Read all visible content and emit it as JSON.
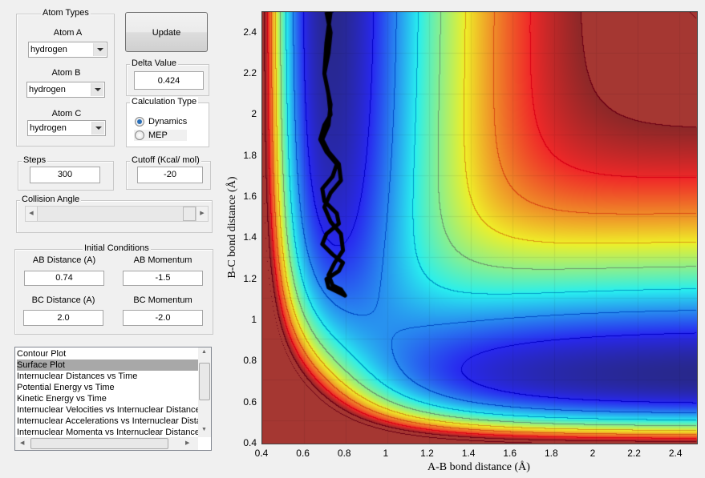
{
  "atom_types": {
    "title": "Atom Types",
    "atom_a_label": "Atom A",
    "atom_a": "hydrogen",
    "atom_b_label": "Atom B",
    "atom_b": "hydrogen",
    "atom_c_label": "Atom C",
    "atom_c": "hydrogen"
  },
  "update_label": "Update",
  "delta": {
    "title": "Delta Value",
    "value": "0.424"
  },
  "calc_type": {
    "title": "Calculation Type",
    "options": [
      "Dynamics",
      "MEP"
    ],
    "selected": "Dynamics"
  },
  "steps": {
    "title": "Steps",
    "value": "300"
  },
  "cutoff": {
    "title": "Cutoff (Kcal/ mol)",
    "value": "-20"
  },
  "collision_angle": {
    "title": "Collision Angle"
  },
  "initial": {
    "title": "Initial Conditions",
    "ab_dist_label": "AB Distance (A)",
    "ab_dist": "0.74",
    "ab_mom_label": "AB Momentum",
    "ab_mom": "-1.5",
    "bc_dist_label": "BC Distance (A)",
    "bc_dist": "2.0",
    "bc_mom_label": "BC Momentum",
    "bc_mom": "-2.0"
  },
  "plot_list": {
    "items": [
      "Contour Plot",
      "Surface Plot",
      "Internuclear Distances vs Time",
      "Potential Energy vs Time",
      "Kinetic Energy vs Time",
      "Internuclear Velocities vs Internuclear Distance",
      "Internuclear Accelerations vs Internuclear Distance",
      "Internuclear Momenta vs Internuclear Distance"
    ],
    "selected": "Surface Plot"
  },
  "chart_data": {
    "type": "contour",
    "xlabel": "A-B bond distance (Å)",
    "ylabel": "B-C bond distance (Å)",
    "xlim": [
      0.4,
      2.5
    ],
    "ylim": [
      0.4,
      2.5
    ],
    "xticks": [
      "0.4",
      "0.6",
      "0.8",
      "1",
      "1.2",
      "1.4",
      "1.6",
      "1.8",
      "2",
      "2.2",
      "2.4"
    ],
    "yticks": [
      "0.4",
      "0.6",
      "0.8",
      "1",
      "1.2",
      "1.4",
      "1.6",
      "1.8",
      "2",
      "2.2",
      "2.4"
    ],
    "colormap": "jet",
    "grid": true,
    "trajectory": {
      "color": "#000000",
      "x": [
        0.71,
        0.73,
        0.72,
        0.7,
        0.72,
        0.73,
        0.7,
        0.68,
        0.71,
        0.76,
        0.74,
        0.69,
        0.7,
        0.76,
        0.77,
        0.71,
        0.69,
        0.74,
        0.79,
        0.77,
        0.71,
        0.72,
        0.78,
        0.8,
        0.78,
        0.74,
        0.72,
        0.75,
        0.79,
        0.78,
        0.73,
        0.7,
        0.73,
        0.78,
        0.77,
        0.72,
        0.69,
        0.72,
        0.73,
        0.7,
        0.71,
        0.73
      ],
      "y": [
        2.5,
        2.4,
        2.3,
        2.2,
        2.1,
        2.0,
        1.95,
        1.88,
        1.82,
        1.76,
        1.7,
        1.64,
        1.58,
        1.52,
        1.47,
        1.42,
        1.37,
        1.32,
        1.28,
        1.24,
        1.2,
        1.16,
        1.13,
        1.12,
        1.15,
        1.17,
        1.22,
        1.28,
        1.34,
        1.42,
        1.48,
        1.55,
        1.62,
        1.68,
        1.76,
        1.82,
        1.88,
        1.95,
        2.05,
        2.2,
        2.35,
        2.5
      ]
    }
  }
}
